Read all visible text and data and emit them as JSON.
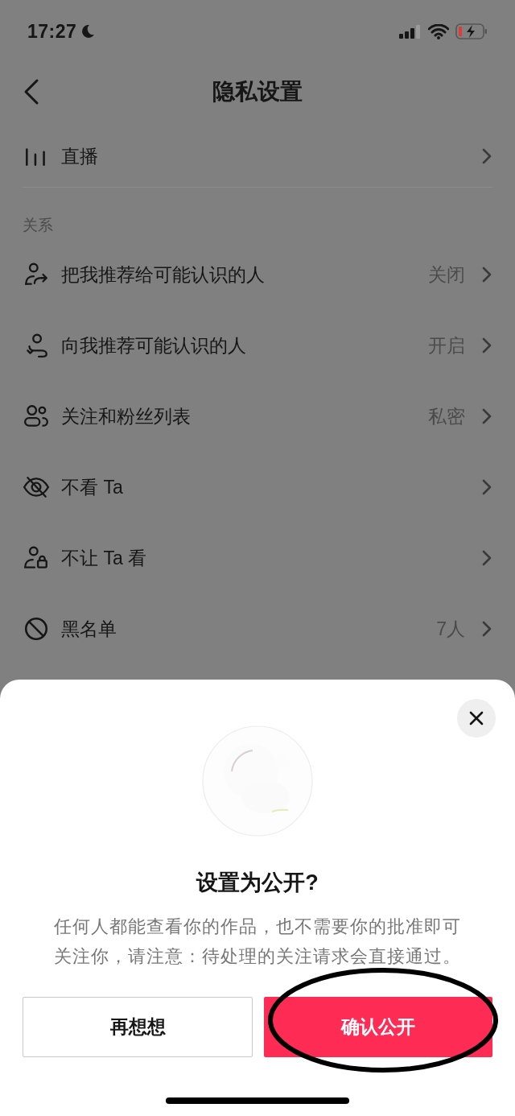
{
  "status_bar": {
    "time": "17:27"
  },
  "nav": {
    "title": "隐私设置"
  },
  "sections": [
    {
      "items": [
        {
          "kind": "live",
          "label": "直播"
        }
      ]
    },
    {
      "header": "关系",
      "items": [
        {
          "kind": "share-person",
          "label": "把我推荐给可能认识的人",
          "value": "关闭"
        },
        {
          "kind": "receive-person",
          "label": "向我推荐可能认识的人",
          "value": "开启"
        },
        {
          "kind": "people",
          "label": "关注和粉丝列表",
          "value": "私密"
        },
        {
          "kind": "eye-off",
          "label": "不看 Ta"
        },
        {
          "kind": "person-lock",
          "label": "不让 Ta 看"
        },
        {
          "kind": "block",
          "label": "黑名单",
          "value": "7人"
        }
      ]
    }
  ],
  "sheet": {
    "title": "设置为公开?",
    "description": "任何人都能查看你的作品，也不需要你的批准即可关注你，请注意：待处理的关注请求会直接通过。",
    "buttons": [
      {
        "kind": "secondary",
        "label": "再想想"
      },
      {
        "kind": "primary",
        "label": "确认公开"
      }
    ]
  }
}
